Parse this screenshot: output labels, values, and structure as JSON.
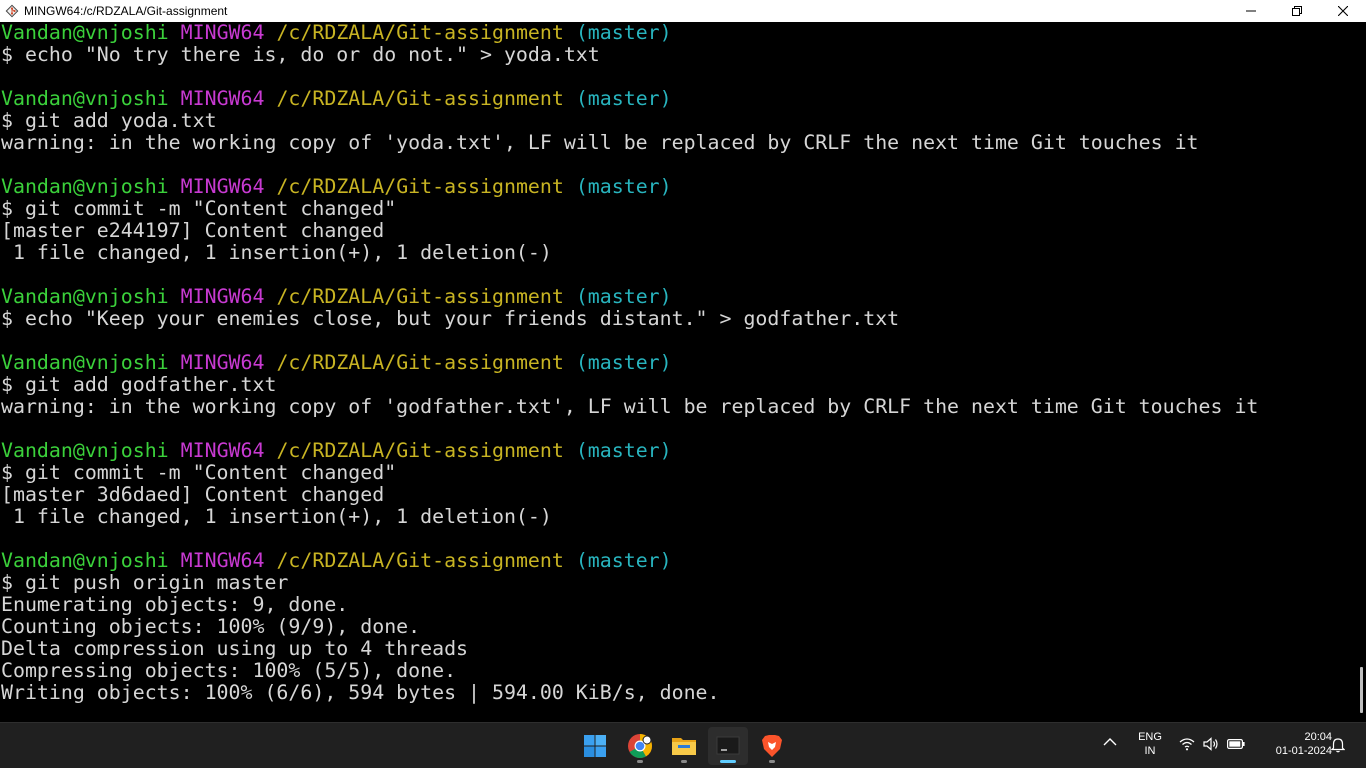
{
  "window": {
    "title": "MINGW64:/c/RDZALA/Git-assignment"
  },
  "terminal": {
    "lines": [
      {
        "segs": [
          {
            "t": "Vandan@vnjoshi ",
            "c": "green"
          },
          {
            "t": "MINGW64 ",
            "c": "magenta"
          },
          {
            "t": "/c/RDZALA/Git-assignment",
            "c": "yellow"
          },
          {
            "t": " (master)",
            "c": "cyan"
          }
        ]
      },
      {
        "segs": [
          {
            "t": "$ echo \"No try there is, do or do not.\" > yoda.txt",
            "c": ""
          }
        ]
      },
      {
        "segs": []
      },
      {
        "segs": [
          {
            "t": "Vandan@vnjoshi ",
            "c": "green"
          },
          {
            "t": "MINGW64 ",
            "c": "magenta"
          },
          {
            "t": "/c/RDZALA/Git-assignment",
            "c": "yellow"
          },
          {
            "t": " (master)",
            "c": "cyan"
          }
        ]
      },
      {
        "segs": [
          {
            "t": "$ git add yoda.txt",
            "c": ""
          }
        ]
      },
      {
        "segs": [
          {
            "t": "warning: in the working copy of 'yoda.txt', LF will be replaced by CRLF the next time Git touches it",
            "c": ""
          }
        ]
      },
      {
        "segs": []
      },
      {
        "segs": [
          {
            "t": "Vandan@vnjoshi ",
            "c": "green"
          },
          {
            "t": "MINGW64 ",
            "c": "magenta"
          },
          {
            "t": "/c/RDZALA/Git-assignment",
            "c": "yellow"
          },
          {
            "t": " (master)",
            "c": "cyan"
          }
        ]
      },
      {
        "segs": [
          {
            "t": "$ git commit -m \"Content changed\"",
            "c": ""
          }
        ]
      },
      {
        "segs": [
          {
            "t": "[master e244197] Content changed",
            "c": ""
          }
        ]
      },
      {
        "segs": [
          {
            "t": " 1 file changed, 1 insertion(+), 1 deletion(-)",
            "c": ""
          }
        ]
      },
      {
        "segs": []
      },
      {
        "segs": [
          {
            "t": "Vandan@vnjoshi ",
            "c": "green"
          },
          {
            "t": "MINGW64 ",
            "c": "magenta"
          },
          {
            "t": "/c/RDZALA/Git-assignment",
            "c": "yellow"
          },
          {
            "t": " (master)",
            "c": "cyan"
          }
        ]
      },
      {
        "segs": [
          {
            "t": "$ echo \"Keep your enemies close, but your friends distant.\" > godfather.txt",
            "c": ""
          }
        ]
      },
      {
        "segs": []
      },
      {
        "segs": [
          {
            "t": "Vandan@vnjoshi ",
            "c": "green"
          },
          {
            "t": "MINGW64 ",
            "c": "magenta"
          },
          {
            "t": "/c/RDZALA/Git-assignment",
            "c": "yellow"
          },
          {
            "t": " (master)",
            "c": "cyan"
          }
        ]
      },
      {
        "segs": [
          {
            "t": "$ git add godfather.txt",
            "c": ""
          }
        ]
      },
      {
        "segs": [
          {
            "t": "warning: in the working copy of 'godfather.txt', LF will be replaced by CRLF the next time Git touches it",
            "c": ""
          }
        ]
      },
      {
        "segs": []
      },
      {
        "segs": [
          {
            "t": "Vandan@vnjoshi ",
            "c": "green"
          },
          {
            "t": "MINGW64 ",
            "c": "magenta"
          },
          {
            "t": "/c/RDZALA/Git-assignment",
            "c": "yellow"
          },
          {
            "t": " (master)",
            "c": "cyan"
          }
        ]
      },
      {
        "segs": [
          {
            "t": "$ git commit -m \"Content changed\"",
            "c": ""
          }
        ]
      },
      {
        "segs": [
          {
            "t": "[master 3d6daed] Content changed",
            "c": ""
          }
        ]
      },
      {
        "segs": [
          {
            "t": " 1 file changed, 1 insertion(+), 1 deletion(-)",
            "c": ""
          }
        ]
      },
      {
        "segs": []
      },
      {
        "segs": [
          {
            "t": "Vandan@vnjoshi ",
            "c": "green"
          },
          {
            "t": "MINGW64 ",
            "c": "magenta"
          },
          {
            "t": "/c/RDZALA/Git-assignment",
            "c": "yellow"
          },
          {
            "t": " (master)",
            "c": "cyan"
          }
        ]
      },
      {
        "segs": [
          {
            "t": "$ git push origin master",
            "c": ""
          }
        ]
      },
      {
        "segs": [
          {
            "t": "Enumerating objects: 9, done.",
            "c": ""
          }
        ]
      },
      {
        "segs": [
          {
            "t": "Counting objects: 100% (9/9), done.",
            "c": ""
          }
        ]
      },
      {
        "segs": [
          {
            "t": "Delta compression using up to 4 threads",
            "c": ""
          }
        ]
      },
      {
        "segs": [
          {
            "t": "Compressing objects: 100% (5/5), done.",
            "c": ""
          }
        ]
      },
      {
        "segs": [
          {
            "t": "Writing objects: 100% (6/6), 594 bytes | 594.00 KiB/s, done.",
            "c": ""
          }
        ]
      }
    ]
  },
  "taskbar": {
    "apps": [
      {
        "name": "start-button",
        "icon": "windows-logo-icon",
        "active": false
      },
      {
        "name": "taskbar-chrome",
        "icon": "chrome-icon",
        "active": false
      },
      {
        "name": "taskbar-file-explorer",
        "icon": "folder-icon",
        "active": false
      },
      {
        "name": "taskbar-git-bash",
        "icon": "terminal-icon",
        "active": true
      },
      {
        "name": "taskbar-brave",
        "icon": "brave-lion-icon",
        "active": false
      }
    ],
    "language_top": "ENG",
    "language_bottom": "IN",
    "time": "20:04",
    "date": "01-01-2024"
  },
  "colors": {
    "prompt_user": "#3bd13b",
    "prompt_system": "#c83ad2",
    "prompt_path": "#c8b423",
    "prompt_branch": "#28b4be",
    "terminal_text": "#d6d6d6",
    "terminal_bg": "#000000",
    "taskbar_bg": "#202020",
    "active_indicator": "#60cdff"
  }
}
